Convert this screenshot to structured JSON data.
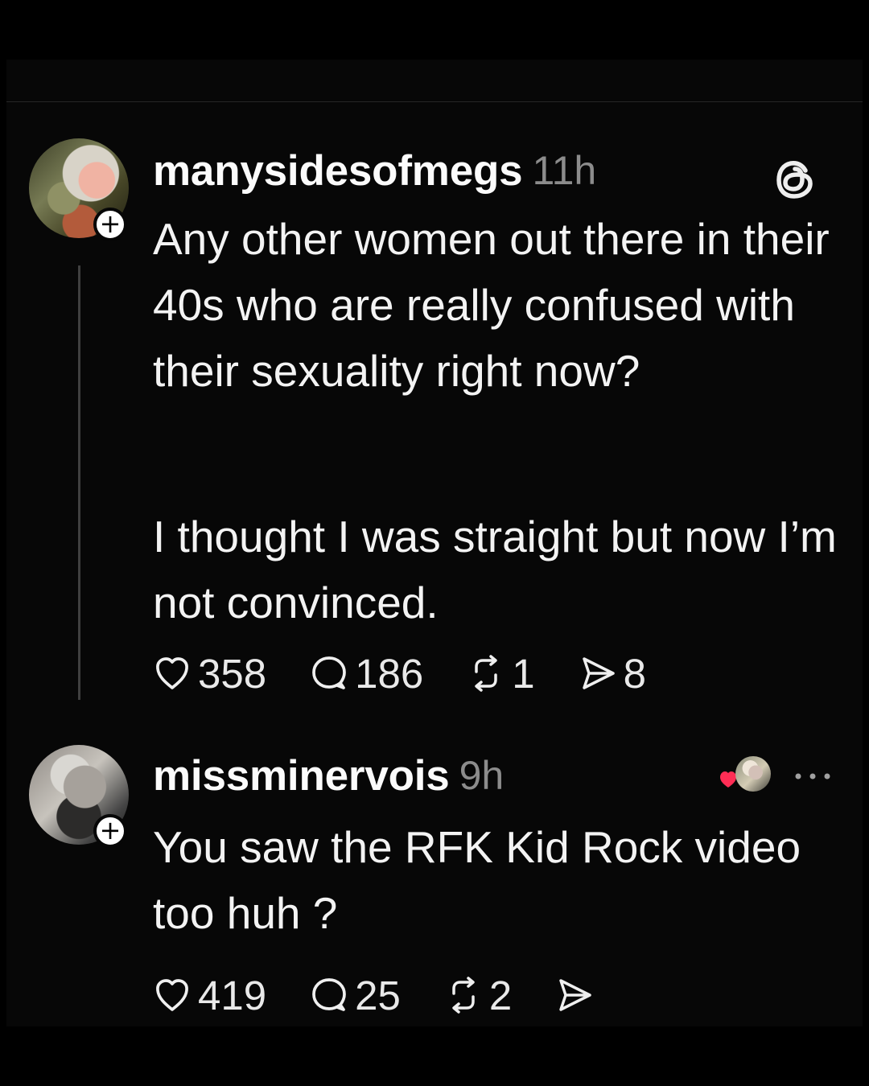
{
  "posts": [
    {
      "username": "manysidesofmegs",
      "time": "11h",
      "text": "Any other women out there in their 40s who are really confused with their sexuality right now?",
      "text_secondary": "I thought I was straight but now I’m not convinced.",
      "follow_badge": "+",
      "actions": {
        "likes": "358",
        "replies": "186",
        "reposts": "1",
        "shares": "8"
      },
      "icon": "threads-icon"
    },
    {
      "username": "missminervois",
      "time": "9h",
      "text": "You saw the RFK Kid Rock video too huh ?",
      "follow_badge": "+",
      "actions": {
        "likes": "419",
        "replies": "25",
        "reposts": "2",
        "shares": ""
      },
      "icon": "more-icon"
    }
  ],
  "colors": {
    "background": "#000000",
    "panel": "#070707",
    "text": "#f3f3f3",
    "muted": "#8c8c8c",
    "divider": "#262626",
    "like_badge": "#ff2d55"
  }
}
